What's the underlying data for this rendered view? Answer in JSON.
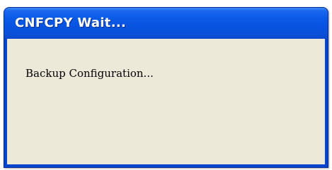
{
  "window": {
    "title": "CNFCPY Wait...",
    "message": "Backup Configuration..."
  },
  "colors": {
    "titlebar": "#0a5ae6",
    "frame": "#0845cf",
    "client_background": "#ece9d8",
    "title_text": "#ffffff"
  }
}
